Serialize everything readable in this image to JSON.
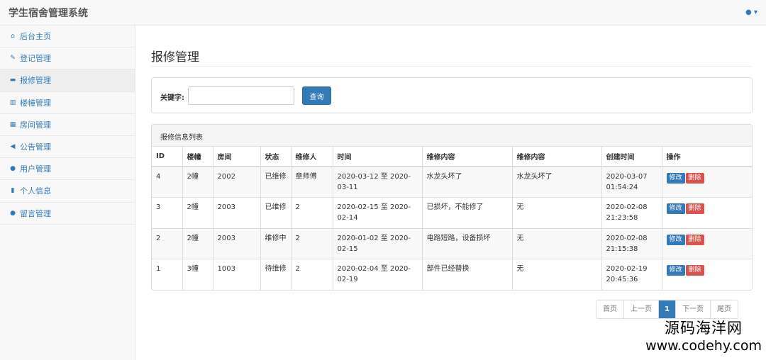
{
  "app": {
    "title": "学生宿舍管理系统"
  },
  "sidebar": {
    "items": [
      {
        "label": "后台主页",
        "icon": "home-icon",
        "glyph": "⌂"
      },
      {
        "label": "登记管理",
        "icon": "pencil-icon",
        "glyph": "✎"
      },
      {
        "label": "报修管理",
        "icon": "briefcase-icon",
        "glyph": "▬"
      },
      {
        "label": "楼幢管理",
        "icon": "building-icon",
        "glyph": "▥"
      },
      {
        "label": "房间管理",
        "icon": "calculator-icon",
        "glyph": "▦"
      },
      {
        "label": "公告管理",
        "icon": "bullhorn-icon",
        "glyph": "◀"
      },
      {
        "label": "用户管理",
        "icon": "user-icon",
        "glyph": "●"
      },
      {
        "label": "个人信息",
        "icon": "bookmark-icon",
        "glyph": "▮"
      },
      {
        "label": "留言管理",
        "icon": "comment-icon",
        "glyph": "●"
      }
    ],
    "active_index": 2
  },
  "page": {
    "title": "报修管理"
  },
  "search": {
    "label": "关键字:",
    "value": "",
    "button": "查询"
  },
  "list": {
    "heading": "报修信息列表",
    "columns": [
      "ID",
      "楼幢",
      "房间",
      "状态",
      "维修人",
      "时间",
      "维修内容",
      "维修内容",
      "创建时间",
      "操作"
    ],
    "rows": [
      {
        "id": "4",
        "building": "2幢",
        "room": "2002",
        "status": "已维修",
        "repairer": "章师傅",
        "time": "2020-03-12 至 2020-03-11",
        "content": "水龙头坏了",
        "content2": "水龙头坏了",
        "created": "2020-03-07 01:54:24"
      },
      {
        "id": "3",
        "building": "2幢",
        "room": "2003",
        "status": "已维修",
        "repairer": "2",
        "time": "2020-02-15 至 2020-02-14",
        "content": "已损坏，不能修了",
        "content2": "无",
        "created": "2020-02-08 21:23:58"
      },
      {
        "id": "2",
        "building": "2幢",
        "room": "2003",
        "status": "维修中",
        "repairer": "2",
        "time": "2020-01-02 至 2020-02-15",
        "content": "电路短路，设备损坏",
        "content2": "无",
        "created": "2020-02-08 21:15:38"
      },
      {
        "id": "1",
        "building": "3幢",
        "room": "1003",
        "status": "待维修",
        "repairer": "2",
        "time": "2020-02-04 至 2020-02-19",
        "content": "部件已经替换",
        "content2": "无",
        "created": "2020-02-19 20:45:36"
      }
    ],
    "edit_label": "修改",
    "delete_label": "删除"
  },
  "pagination": {
    "first": "首页",
    "prev": "上一页",
    "current": "1",
    "next": "下一页",
    "last": "尾页"
  },
  "watermark": {
    "cn": "源码海洋网",
    "en": "www.codehy.com"
  },
  "colors": {
    "primary": "#337ab7",
    "danger": "#d9534f",
    "sidebar_bg": "#f8f8f8"
  }
}
